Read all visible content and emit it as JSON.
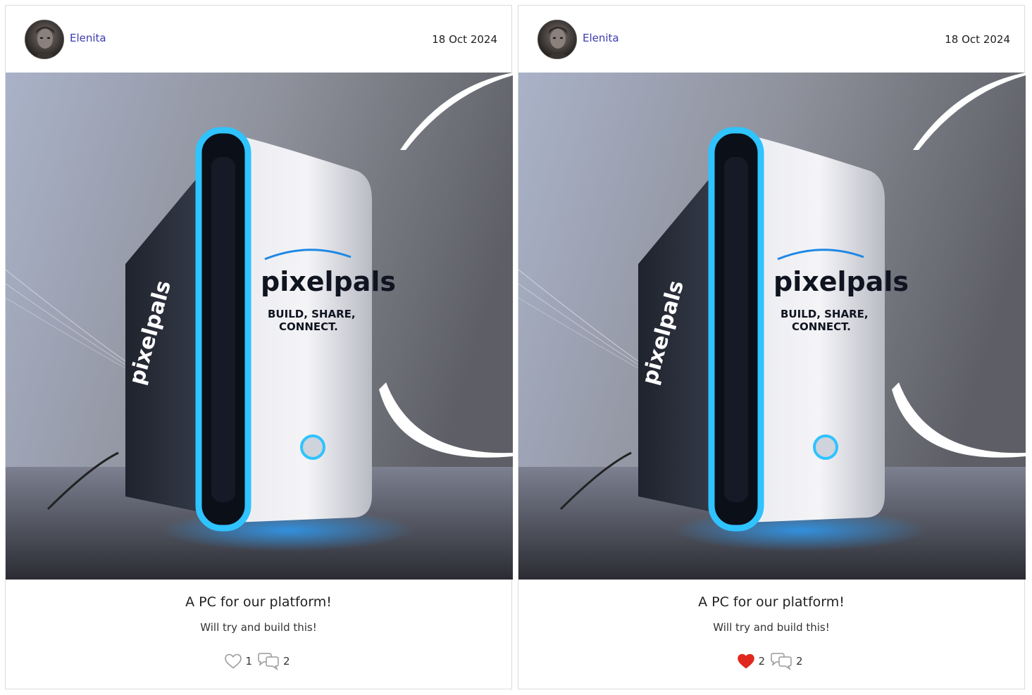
{
  "posts": [
    {
      "author": "Elenita",
      "date": "18 Oct 2024",
      "title": "A PC for our platform!",
      "description": "Will try and build this!",
      "likes": "1",
      "comments": "2",
      "liked": false,
      "image_alt_text": {
        "brand_main": "pixelpals",
        "tagline_line1": "BUILD, SHARE,",
        "tagline_line2": "CONNECT.",
        "brand_side": "pixelpals"
      }
    },
    {
      "author": "Elenita",
      "date": "18 Oct 2024",
      "title": "A PC for our platform!",
      "description": "Will try and build this!",
      "likes": "2",
      "comments": "2",
      "liked": true,
      "image_alt_text": {
        "brand_main": "pixelpals",
        "tagline_line1": "BUILD, SHARE,",
        "tagline_line2": "CONNECT.",
        "brand_side": "pixelpals"
      }
    }
  ],
  "colors": {
    "author_link": "#3b3bb0",
    "like_active": "#e0281e",
    "glow": "#29b6ff"
  },
  "icons": [
    "heart-icon",
    "comments-icon"
  ]
}
